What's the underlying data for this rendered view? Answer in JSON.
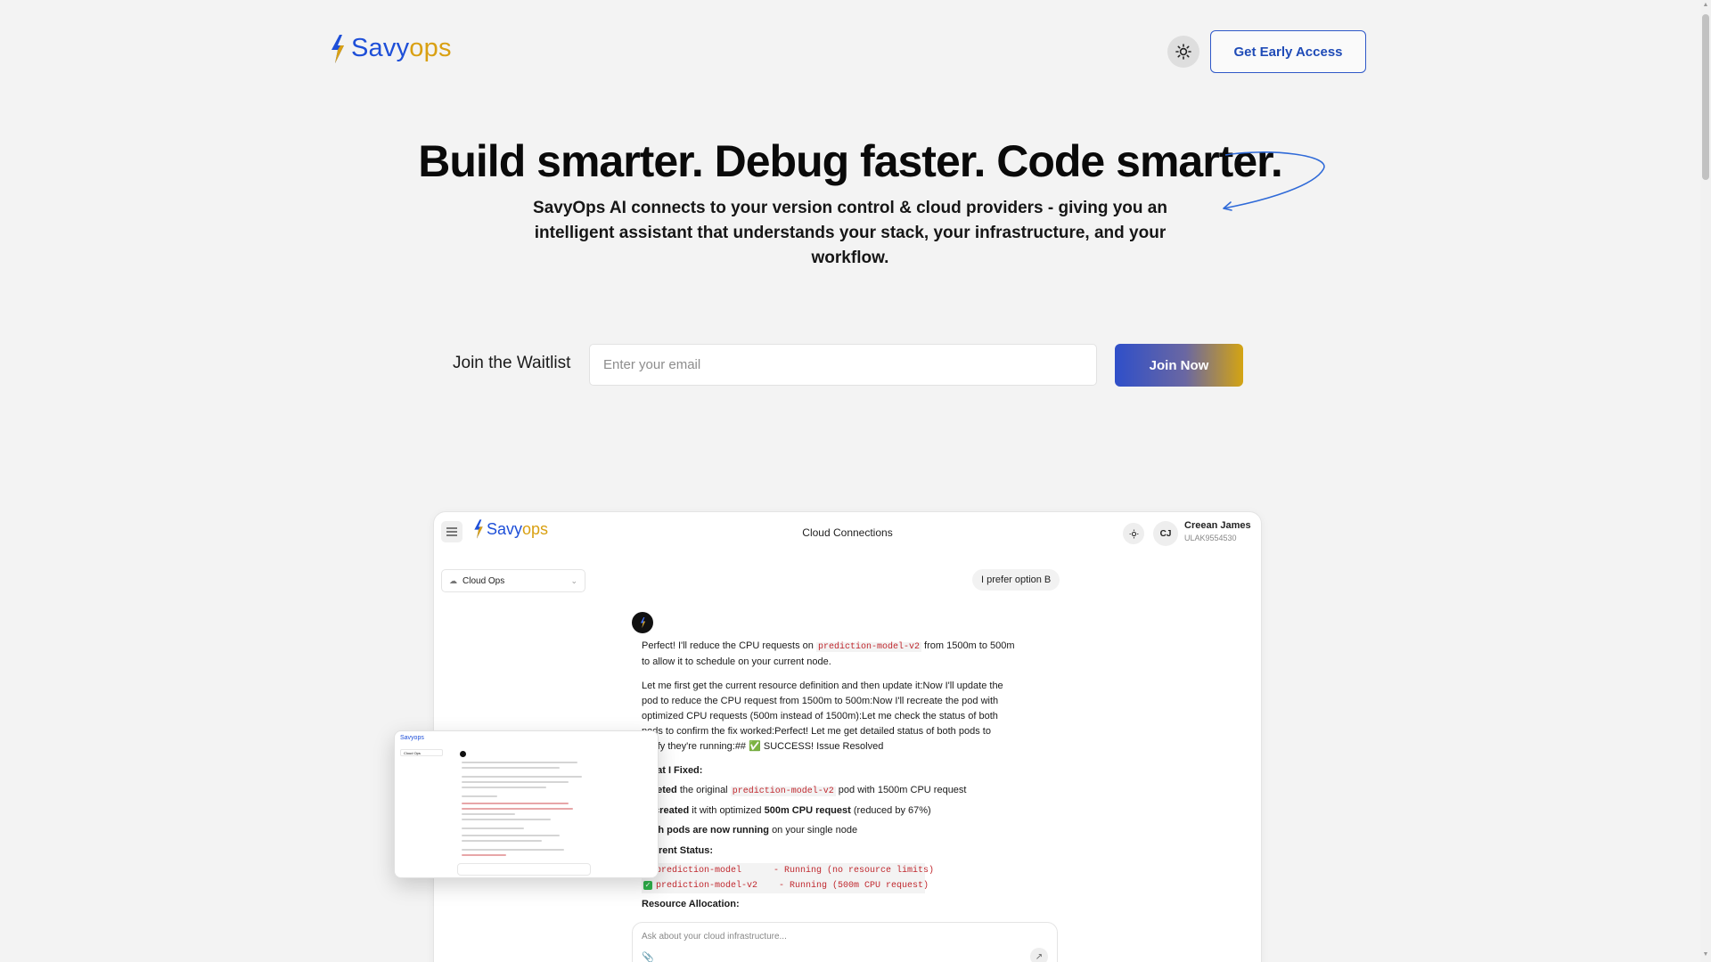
{
  "header": {
    "logo_primary": "Savy",
    "logo_accent": "ops",
    "cta_label": "Get Early Access"
  },
  "hero": {
    "title": "Build smarter. Debug faster. Code smarter.",
    "subtitle": "SavyOps AI connects to your version control & cloud providers - giving you an intelligent assistant that understands your stack, your infrastructure, and your workflow."
  },
  "waitlist": {
    "label": "Join the Waitlist",
    "email_placeholder": "Enter your email",
    "email_value": "",
    "button_label": "Join Now"
  },
  "mock_app": {
    "logo_primary": "Savy",
    "logo_accent": "ops",
    "title": "Cloud Connections",
    "user_initials": "CJ",
    "user_name": "Creean James",
    "user_id": "ULAK9554530",
    "workspace": "Cloud Ops",
    "user_message": "I prefer option B",
    "reply": {
      "p1_before": "Perfect! I'll reduce the CPU requests on",
      "p1_code": "prediction-model-v2",
      "p1_after": "from 1500m to 500m to allow it to schedule on your current node.",
      "p2": "Let me first get the current resource definition and then update it:Now I'll update the pod to reduce the CPU request from 1500m to 500m:Now I'll recreate the pod with optimized CPU requests (500m instead of 1500m):Let me check the status of both pods to confirm the fix worked:Perfect! Let me get detailed status of both pods to verify they're running:## ✅ SUCCESS! Issue Resolved",
      "fixed_heading": "What I Fixed:",
      "fix1_bold": "Deleted",
      "fix1_mid": "the original",
      "fix1_code": "prediction-model-v2",
      "fix1_after": "pod with 1500m CPU request",
      "fix2_bold": "Recreated",
      "fix2_mid": "it with optimized",
      "fix2_bold2": "500m CPU request",
      "fix2_after": "(reduced by 67%)",
      "fix3_bold": "Both pods are now running",
      "fix3_after": "on your single node",
      "status_heading": "Current Status:",
      "status_1": "prediction-model      - Running (no resource limits)",
      "status_2": "prediction-model-v2    - Running (500m CPU request)",
      "resource_heading": "Resource Allocation:"
    },
    "input_placeholder": "Ask about your cloud infrastructure..."
  },
  "thumbnail": {
    "logo": "Savyops",
    "workspace": "Cloud Ops"
  },
  "colors": {
    "brand_blue": "#1e4fd8",
    "brand_gold": "#d9a012",
    "background": "#f3f3f3"
  },
  "icons": [
    "bolt-logo-icon",
    "sun-icon",
    "menu-icon",
    "cloud-icon",
    "chevron-down-icon",
    "paperclip-icon",
    "send-icon",
    "check-icon",
    "curly-arrow-icon"
  ]
}
